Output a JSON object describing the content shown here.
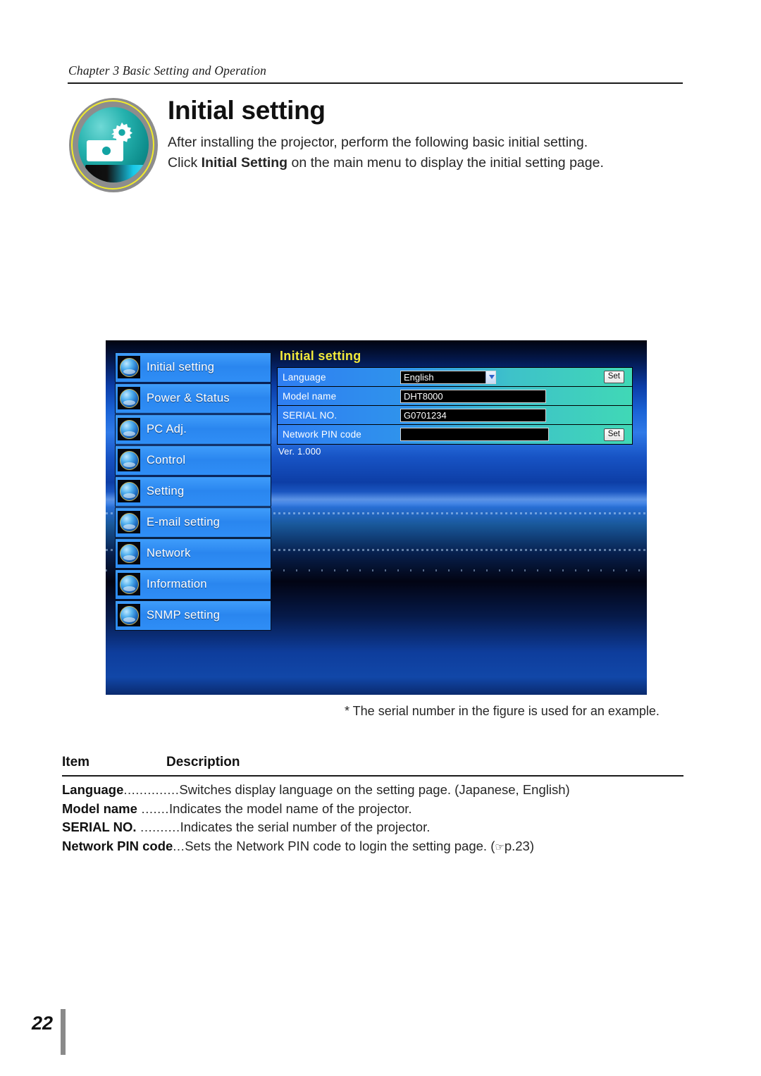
{
  "running_head": "Chapter 3 Basic Setting and Operation",
  "title": "Initial setting",
  "intro": {
    "line1": "After installing the projector, perform the following basic initial setting.",
    "line2_pre": "Click ",
    "line2_bold": "Initial Setting",
    "line2_post": " on the main menu to display the initial setting page."
  },
  "screenshot": {
    "pane_title": "Initial setting",
    "nav_items": [
      {
        "label": "Initial setting",
        "icon": "initial-setting-orb-icon"
      },
      {
        "label": "Power & Status",
        "icon": "power-status-orb-icon"
      },
      {
        "label": "PC Adj.",
        "icon": "pc-adj-orb-icon"
      },
      {
        "label": "Control",
        "icon": "control-orb-icon"
      },
      {
        "label": "Setting",
        "icon": "setting-orb-icon"
      },
      {
        "label": "E-mail setting",
        "icon": "email-setting-orb-icon"
      },
      {
        "label": "Network",
        "icon": "network-orb-icon"
      },
      {
        "label": "Information",
        "icon": "information-orb-icon"
      },
      {
        "label": "SNMP setting",
        "icon": "snmp-setting-orb-icon"
      }
    ],
    "rows": {
      "language": {
        "label": "Language",
        "value": "English",
        "set_label": "Set"
      },
      "model_name": {
        "label": "Model name",
        "value": "DHT8000"
      },
      "serial_no": {
        "label": "SERIAL NO.",
        "value": "G0701234"
      },
      "network_pin": {
        "label": "Network PIN code",
        "value": "",
        "set_label": "Set"
      }
    },
    "version": "Ver. 1.000"
  },
  "footnote": "* The serial number in the figure is used for an example.",
  "desc_table": {
    "header_item": "Item",
    "header_description": "Description",
    "rows": [
      {
        "term": "Language",
        "dots": "..............",
        "text": "Switches display language on the setting page. (Japanese, English)"
      },
      {
        "term": "Model name",
        "dots": " .......",
        "text": "Indicates the model name of the projector."
      },
      {
        "term": "SERIAL NO.",
        "dots": " ..........",
        "text": "Indicates the serial number of the projector."
      },
      {
        "term": "Network PIN code",
        "dots": "...",
        "text": "Sets the Network PIN code to login the setting page. (",
        "ref": "p.23)"
      }
    ]
  },
  "folio": "22"
}
